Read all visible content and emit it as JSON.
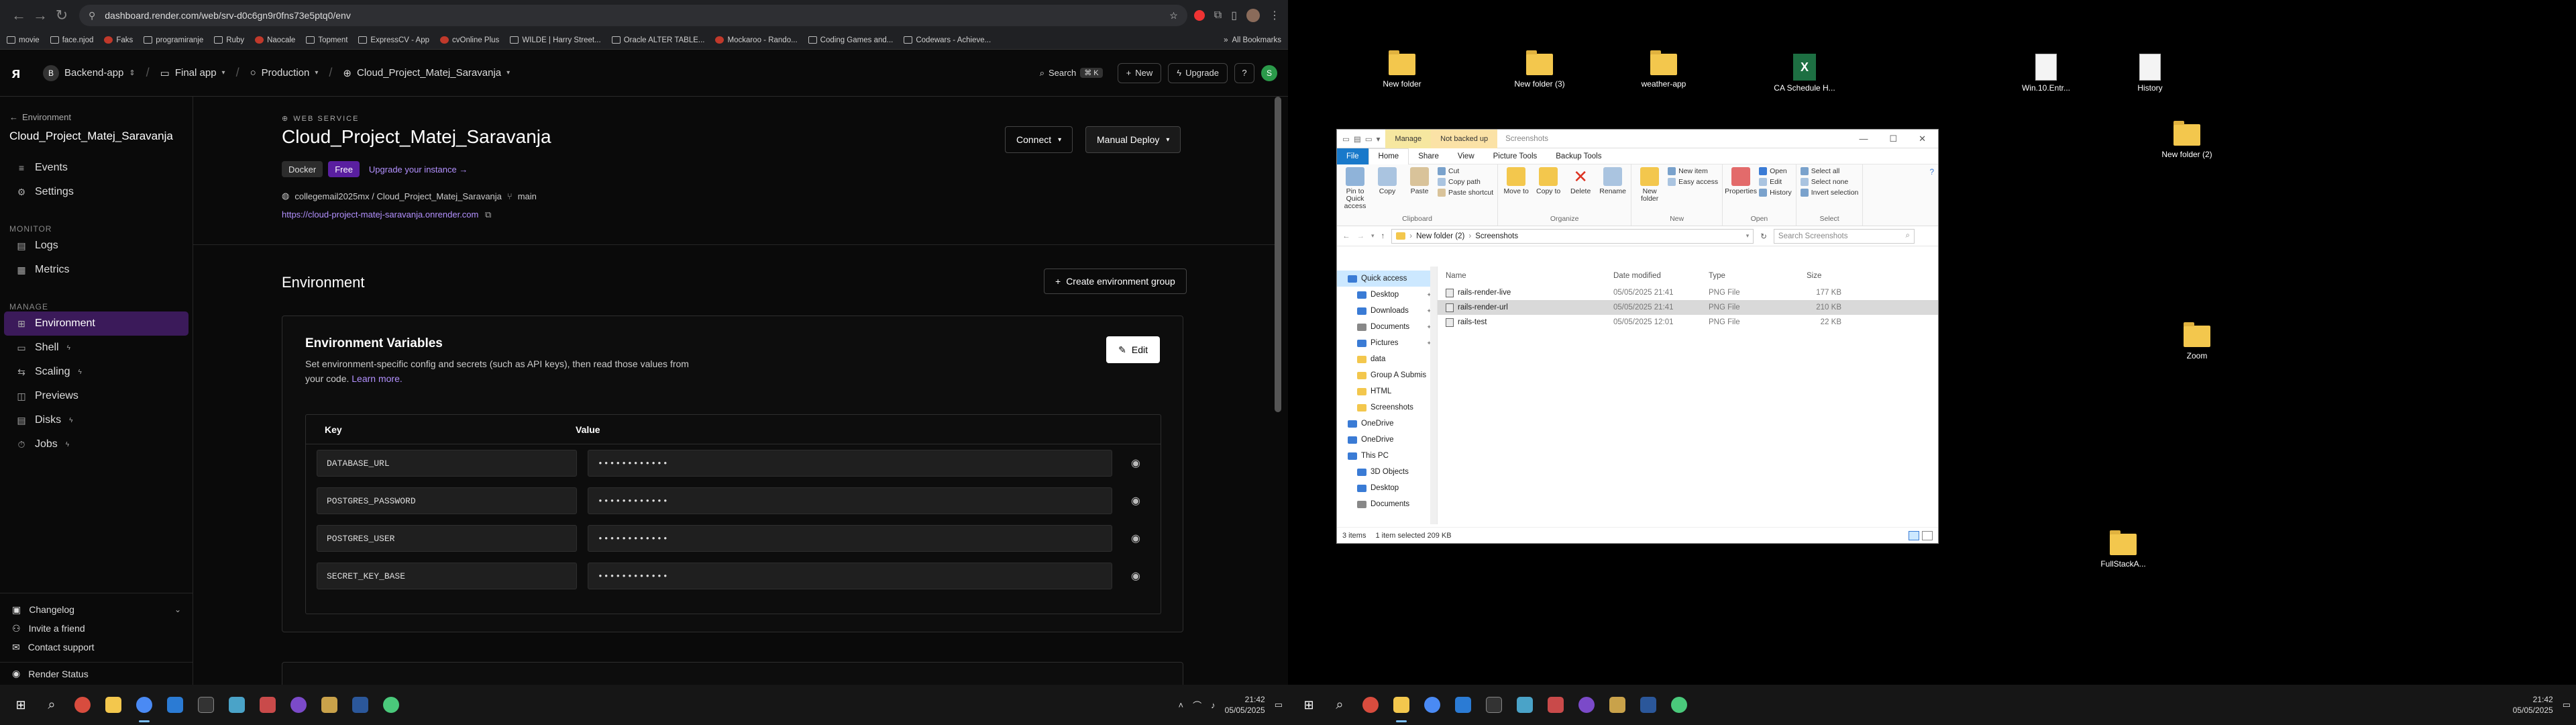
{
  "browser": {
    "url": "dashboard.render.com/web/srv-d0c6gn9r0fns73e5ptq0/env",
    "bookmarks": [
      "movie",
      "face.njod",
      "Faks",
      "programiranje",
      "Ruby",
      "Naocale",
      "Topment",
      "ExpressCV - App",
      "cvOnline Plus",
      "WILDE | Harry Street...",
      "Oracle ALTER TABLE...",
      "Mockaroo - Rando...",
      "Coding Games and...",
      "Codewars - Achieve..."
    ],
    "all_bookmarks": "All Bookmarks"
  },
  "topbar": {
    "workspace_initial": "B",
    "workspace": "Backend-app",
    "project": "Final app",
    "environment": "Production",
    "service": "Cloud_Project_Matej_Saravanja",
    "search": "Search",
    "search_kbd": "⌘ K",
    "new": "New",
    "upgrade": "Upgrade",
    "user_initial": "S"
  },
  "sidebar": {
    "back": "Environment",
    "title": "Cloud_Project_Matej_Saravanja",
    "items_top": [
      {
        "label": "Events",
        "icon": "≡"
      },
      {
        "label": "Settings",
        "icon": "⚙"
      }
    ],
    "monitor_label": "MONITOR",
    "items_monitor": [
      {
        "label": "Logs",
        "icon": "▤"
      },
      {
        "label": "Metrics",
        "icon": "▦"
      }
    ],
    "manage_label": "MANAGE",
    "items_manage": [
      {
        "label": "Environment",
        "icon": "⊞",
        "active": true
      },
      {
        "label": "Shell",
        "icon": "▭"
      },
      {
        "label": "Scaling",
        "icon": "⇆"
      },
      {
        "label": "Previews",
        "icon": "◫"
      },
      {
        "label": "Disks",
        "icon": "▤"
      },
      {
        "label": "Jobs",
        "icon": "⏱"
      }
    ],
    "changelog": "Changelog",
    "invite": "Invite a friend",
    "support": "Contact support",
    "status": "Render Status"
  },
  "service": {
    "type": "WEB SERVICE",
    "name": "Cloud_Project_Matej_Saravanja",
    "badge_docker": "Docker",
    "badge_free": "Free",
    "upgrade_link": "Upgrade your instance →",
    "repo": "collegemail2025mx / Cloud_Project_Matej_Saravanja",
    "branch": "main",
    "url": "https://cloud-project-matej-saravanja.onrender.com",
    "connect": "Connect",
    "manual_deploy": "Manual Deploy"
  },
  "environment": {
    "title": "Environment",
    "create_group": "Create environment group",
    "card_title": "Environment Variables",
    "card_desc": "Set environment-specific config and secrets (such as API keys), then read those values from your code.",
    "learn_more": "Learn more.",
    "edit": "Edit",
    "col_key": "Key",
    "col_value": "Value",
    "vars": [
      {
        "key": "DATABASE_URL",
        "value": "••••••••••••"
      },
      {
        "key": "POSTGRES_PASSWORD",
        "value": "••••••••••••"
      },
      {
        "key": "POSTGRES_USER",
        "value": "••••••••••••"
      },
      {
        "key": "SECRET_KEY_BASE",
        "value": "••••••••••••"
      }
    ]
  },
  "taskbar": {
    "time": "21:42",
    "date": "05/05/2025"
  },
  "desktop_icons": [
    {
      "label": "New folder",
      "type": "folder"
    },
    {
      "label": "New folder (3)",
      "type": "folder"
    },
    {
      "label": "weather-app",
      "type": "folder"
    },
    {
      "label": "CA Schedule H...",
      "type": "excel"
    },
    {
      "label": "Win.10.Entr...",
      "type": "doc"
    },
    {
      "label": "History",
      "type": "doc"
    },
    {
      "label": "New folder (2)",
      "type": "folder"
    },
    {
      "label": "Zoom",
      "type": "folder"
    },
    {
      "label": "FullStackA...",
      "type": "folder"
    }
  ],
  "explorer": {
    "tab_manage": "Manage",
    "tab_backup": "Not backed up",
    "title": "Screenshots",
    "tabs": [
      "File",
      "Home",
      "Share",
      "View",
      "Picture Tools",
      "Backup Tools"
    ],
    "ribbon": {
      "pin": "Pin to Quick access",
      "copy": "Copy",
      "paste": "Paste",
      "cut": "Cut",
      "copy_path": "Copy path",
      "paste_shortcut": "Paste shortcut",
      "move_to": "Move to",
      "copy_to": "Copy to",
      "delete": "Delete",
      "rename": "Rename",
      "new_folder": "New folder",
      "new_item": "New item",
      "easy_access": "Easy access",
      "properties": "Properties",
      "open": "Open",
      "edit": "Edit",
      "history": "History",
      "select_all": "Select all",
      "select_none": "Select none",
      "invert": "Invert selection",
      "g_clipboard": "Clipboard",
      "g_organize": "Organize",
      "g_new": "New",
      "g_open": "Open",
      "g_select": "Select"
    },
    "path": [
      "New folder (2)",
      "Screenshots"
    ],
    "search_placeholder": "Search Screenshots",
    "nav": [
      {
        "label": "Quick access",
        "level": 1,
        "sel": true,
        "color": "#3a7bd5"
      },
      {
        "label": "Desktop",
        "level": 2,
        "pin": true,
        "color": "#3a7bd5"
      },
      {
        "label": "Downloads",
        "level": 2,
        "pin": true,
        "color": "#3a7bd5"
      },
      {
        "label": "Documents",
        "level": 2,
        "pin": true,
        "color": "#888"
      },
      {
        "label": "Pictures",
        "level": 2,
        "pin": true,
        "color": "#3a7bd5"
      },
      {
        "label": "data",
        "level": 2,
        "color": "#f3c74d"
      },
      {
        "label": "Group A Submis",
        "level": 2,
        "color": "#f3c74d"
      },
      {
        "label": "HTML",
        "level": 2,
        "color": "#f3c74d"
      },
      {
        "label": "Screenshots",
        "level": 2,
        "color": "#f3c74d"
      },
      {
        "label": "OneDrive",
        "level": 1,
        "color": "#3a7bd5"
      },
      {
        "label": "OneDrive",
        "level": 1,
        "color": "#3a7bd5"
      },
      {
        "label": "This PC",
        "level": 1,
        "color": "#3a7bd5"
      },
      {
        "label": "3D Objects",
        "level": 2,
        "color": "#3a7bd5"
      },
      {
        "label": "Desktop",
        "level": 2,
        "color": "#3a7bd5"
      },
      {
        "label": "Documents",
        "level": 2,
        "color": "#888"
      }
    ],
    "columns": {
      "name": "Name",
      "date": "Date modified",
      "type": "Type",
      "size": "Size"
    },
    "files": [
      {
        "name": "rails-render-live",
        "date": "05/05/2025 21:41",
        "type": "PNG File",
        "size": "177 KB",
        "sel": false
      },
      {
        "name": "rails-render-url",
        "date": "05/05/2025 21:41",
        "type": "PNG File",
        "size": "210 KB",
        "sel": true
      },
      {
        "name": "rails-test",
        "date": "05/05/2025 12:01",
        "type": "PNG File",
        "size": "22 KB",
        "sel": false
      }
    ],
    "status_items": "3 items",
    "status_selected": "1 item selected  209 KB"
  }
}
